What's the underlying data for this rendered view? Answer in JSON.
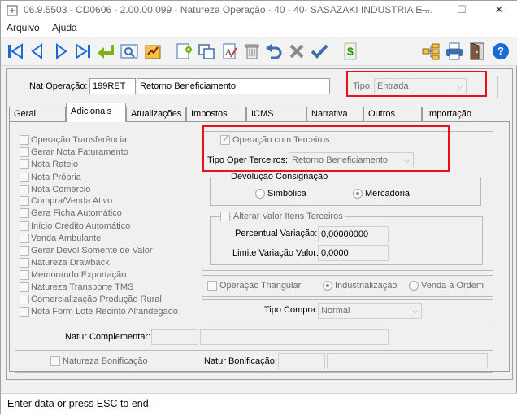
{
  "window": {
    "title": "06.9.5503 - CD0606 - 2.00.00.099 - Natureza Operação - 40 - 40- SASAZAKI INDUSTRIA E ...",
    "minimize": "—",
    "maximize": "☐",
    "close": "✕"
  },
  "menu": {
    "arquivo": "Arquivo",
    "ajuda": "Ajuda"
  },
  "toolbar": {
    "icons": [
      "first-record-icon",
      "previous-record-icon",
      "next-record-icon",
      "last-record-icon",
      "return-icon",
      "preview-icon",
      "report-icon",
      "new-document-icon",
      "copy-icon",
      "edit-text-icon",
      "delete-icon",
      "undo-icon",
      "cancel-icon",
      "confirm-icon",
      "money-icon",
      "tree-structure-icon",
      "print-icon",
      "exit-door-icon",
      "help-icon"
    ],
    "help": "?"
  },
  "header": {
    "nat_op_label": "Nat Operação:",
    "nat_op_code": "199RET",
    "nat_op_desc": "Retorno Beneficiamento",
    "tipo_label": "Tipo:",
    "tipo_value": "Entrada"
  },
  "tabs": [
    "Geral",
    "Adicionais",
    "Atualizações",
    "Impostos",
    "ICMS",
    "Narrativa",
    "Outros",
    "Importação"
  ],
  "active_tab": "Adicionais",
  "checkboxes": [
    "Operação Transferência",
    "Gerar Nota Faturamento",
    "Nota Rateio",
    "Nota Própria",
    "Nota Comércio",
    "Compra/Venda Ativo",
    "Gera Ficha Automático",
    "Início Crédito Automático",
    "Venda Ambulante",
    "Gerar Devol Somente de Valor",
    "Natureza Drawback",
    "Memorando Exportação",
    "Natureza Transporte TMS",
    "Comercialização Produção Rural",
    "Nota Form Lote Recinto Alfandegado"
  ],
  "terceiros": {
    "op_terceiros": "Operação com Terceiros",
    "tipo_oper_label": "Tipo Oper Terceiros:",
    "tipo_oper_value": "Retorno Beneficiamento"
  },
  "devolucao": {
    "title": "Devolução Consignação",
    "simbolica": "Simbólica",
    "mercadoria": "Mercadoria"
  },
  "alterar": {
    "title": "Alterar Valor Itens Terceiros",
    "perc_label": "Percentual Variação:",
    "perc_value": "0,00000000",
    "limite_label": "Limite Variação Valor:",
    "limite_value": "0,0000"
  },
  "triangular": {
    "label": "Operação Triangular",
    "industrializacao": "Industrialização",
    "venda_ordem": "Venda à Ordem"
  },
  "tipo_compra": {
    "label": "Tipo Compra:",
    "value": "Normal"
  },
  "natur_comp_label": "Natur Complementar:",
  "natureza_bonificacao": "Natureza Bonificação",
  "natur_bonif_label": "Natur Bonificação:",
  "status": "Enter data or press ESC to end.",
  "colors": {
    "highlight": "#e8101a",
    "toolbar_blue": "#1a6ad6",
    "toolbar_green": "#7ab317"
  }
}
